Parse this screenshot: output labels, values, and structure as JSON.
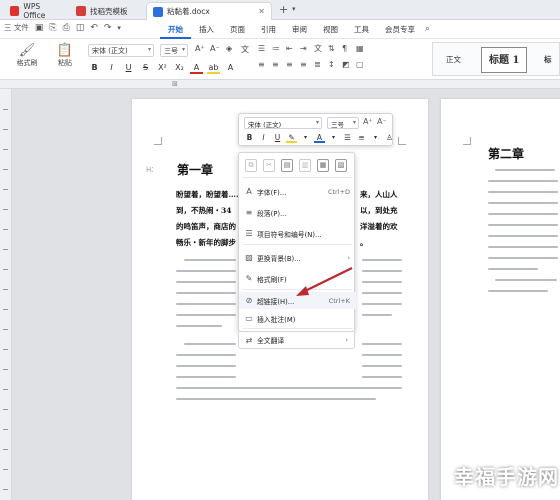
{
  "tabs": [
    {
      "label": "WPS Office",
      "color": "#e0312b"
    },
    {
      "label": "找稻壳模板",
      "color": "#d63c3c"
    },
    {
      "label": "粘黏着.docx",
      "color": "#2b6ee0"
    }
  ],
  "menubar": {
    "file_label": "三 文件",
    "items": [
      "开始",
      "插入",
      "页面",
      "引用",
      "审阅",
      "视图",
      "工具",
      "会员专享"
    ],
    "active": "开始"
  },
  "ribbon": {
    "format_painter": "格式刷",
    "paste": "粘贴",
    "font_name": "宋体 (正文)",
    "font_size": "三号",
    "styles": [
      "正文",
      "标题 1",
      "标题"
    ]
  },
  "mini_toolbar": {
    "font_name": "宋体 (正文)",
    "font_size": "三号"
  },
  "context_menu": {
    "items": [
      {
        "label": "字体(F)...",
        "shortcut": "Ctrl+D",
        "icon": "font-icon",
        "glyph": "A"
      },
      {
        "label": "段落(P)...",
        "shortcut": "",
        "icon": "paragraph-icon",
        "glyph": "≡"
      },
      {
        "label": "项目符号和编号(N)...",
        "shortcut": "",
        "icon": "list-icon",
        "glyph": "☰"
      },
      {
        "label": "更换背景(B)...",
        "shortcut": "",
        "icon": "background-icon",
        "glyph": "▨",
        "submenu": true
      },
      {
        "label": "格式刷(F)",
        "shortcut": "",
        "icon": "format-painter-icon",
        "glyph": "✎"
      },
      {
        "label": "超链接(H)...",
        "shortcut": "Ctrl+K",
        "icon": "hyperlink-icon",
        "glyph": "⊘"
      },
      {
        "label": "插入批注(M)",
        "shortcut": "",
        "icon": "comment-icon",
        "glyph": "▭"
      },
      {
        "label": "全文翻译",
        "shortcut": "",
        "icon": "translate-icon",
        "glyph": "⇄",
        "submenu": true
      }
    ]
  },
  "document": {
    "page1_heading": "第一章",
    "page1_bold_lines": [
      "盼望着，盼望着……",
      "到，不热闹・34",
      "的鸣笛声，商店的",
      "畅乐・新年的脚步"
    ],
    "page1_bold_right": [
      "来，人山人",
      "以，到处充",
      "洋溢着的欢",
      "。"
    ],
    "page2_heading": "第二章"
  },
  "watermark": "幸福手游网",
  "accent_color": "#1a66d9",
  "annotation_color": "#c0262d"
}
